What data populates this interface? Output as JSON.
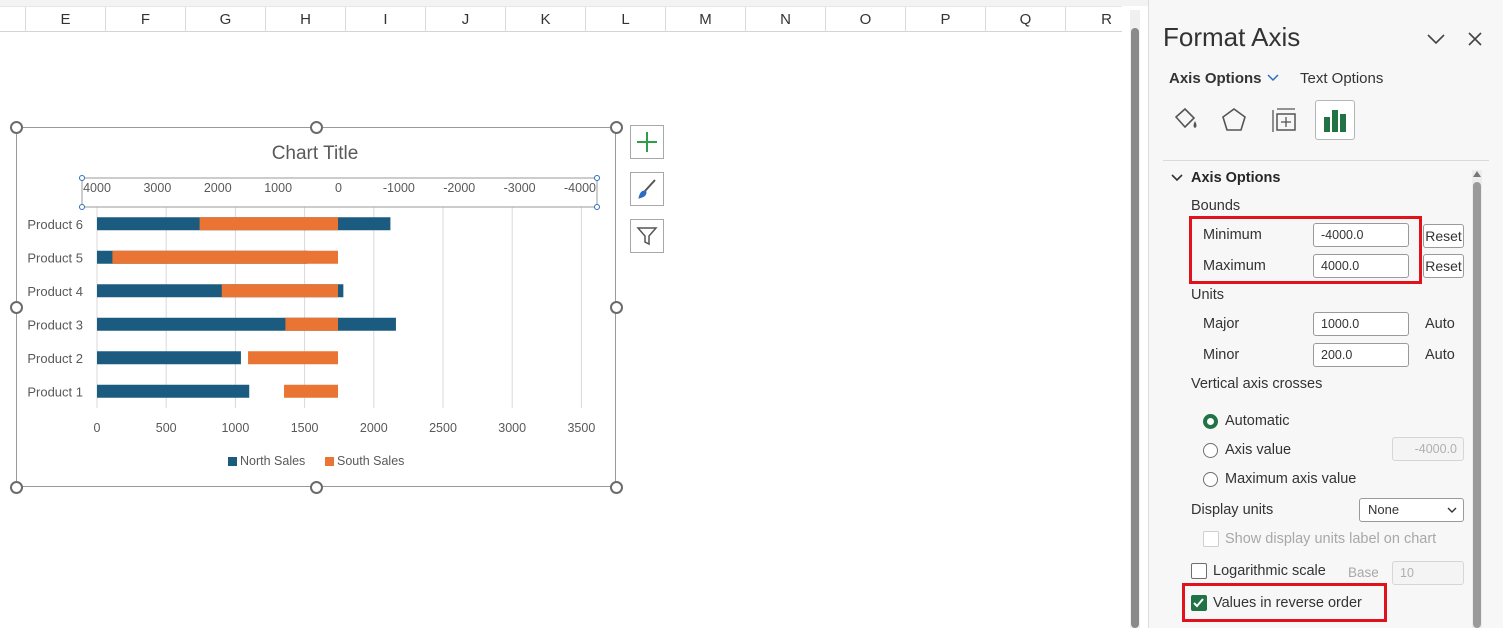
{
  "sheet": {
    "columns": [
      "E",
      "F",
      "G",
      "H",
      "I",
      "J",
      "K",
      "L",
      "M",
      "N",
      "O",
      "P",
      "Q",
      "R"
    ]
  },
  "chart_data": {
    "type": "bar",
    "title": "Chart Title",
    "categories": [
      "Product 6",
      "Product 5",
      "Product 4",
      "Product 3",
      "Product 2",
      "Product 1"
    ],
    "series": [
      {
        "name": "North Sales",
        "color": "#1b5b7f",
        "values": [
          2120,
          1520,
          1780,
          2160,
          1040,
          1100
        ]
      },
      {
        "name": "South Sales",
        "color": "#ea7434",
        "values": [
          1000,
          1630,
          840,
          380,
          650,
          390
        ]
      }
    ],
    "top_axis_ticks": [
      "4000",
      "3000",
      "2000",
      "1000",
      "0",
      "-1000",
      "-2000",
      "-3000",
      "-4000"
    ],
    "bottom_axis_ticks": [
      "0",
      "500",
      "1000",
      "1500",
      "2000",
      "2500",
      "3000",
      "3500"
    ],
    "legend_position": "bottom",
    "grid": true
  },
  "pane": {
    "title": "Format Axis",
    "tab_axis_options": "Axis Options",
    "tab_text_options": "Text Options",
    "section_axis_options": "Axis Options",
    "bounds_label": "Bounds",
    "minimum_label": "Minimum",
    "minimum_value": "-4000.0",
    "maximum_label": "Maximum",
    "maximum_value": "4000.0",
    "reset_label": "Reset",
    "units_label": "Units",
    "major_label": "Major",
    "major_value": "1000.0",
    "minor_label": "Minor",
    "minor_value": "200.0",
    "auto_label": "Auto",
    "vertical_axis_crosses_label": "Vertical axis crosses",
    "automatic_label": "Automatic",
    "axis_value_label": "Axis value",
    "axis_value_value": "-4000.0",
    "maximum_axis_value_label": "Maximum axis value",
    "display_units_label": "Display units",
    "display_units_value": "None",
    "show_display_units_label": "Show display units label on chart",
    "log_scale_label": "Logarithmic scale",
    "base_label": "Base",
    "base_value": "10",
    "values_reverse_label": "Values in reverse order",
    "values_reverse_checked": true
  }
}
